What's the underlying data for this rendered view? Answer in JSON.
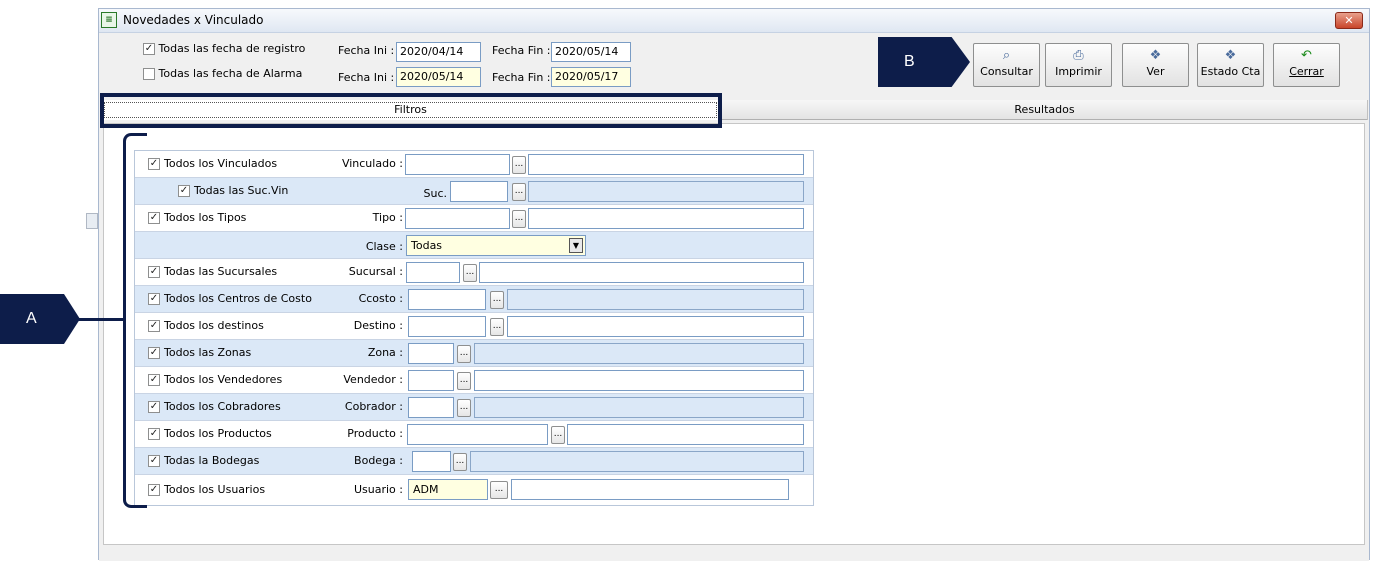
{
  "window": {
    "title": "Novedades x Vinculado",
    "close_label": "✕"
  },
  "date_options": [
    {
      "checked": true,
      "label": "Todas las fecha de registro",
      "ini_label": "Fecha Ini :",
      "ini_value": "2020/04/14",
      "fin_label": "Fecha Fin :",
      "fin_value": "2020/05/14",
      "highlight": false
    },
    {
      "checked": false,
      "label": "Todas las fecha de Alarma",
      "ini_label": "Fecha Ini :",
      "ini_value": "2020/05/14",
      "fin_label": "Fecha Fin :",
      "fin_value": "2020/05/17",
      "highlight": true
    }
  ],
  "toolbar": {
    "consultar": "Consultar",
    "imprimir": "Imprimir",
    "ver": "Ver",
    "estado_cta": "Estado Cta",
    "cerrar": "Cerrar"
  },
  "tabs": {
    "filtros": "Filtros",
    "resultados": "Resultados"
  },
  "filters": {
    "vinculados": {
      "check": "Todos los Vinculados",
      "label": "Vinculado :"
    },
    "suc_vin": {
      "check": "Todas las Suc.Vin",
      "label": "Suc."
    },
    "tipos": {
      "check": "Todos los Tipos",
      "label": "Tipo :"
    },
    "clase": {
      "label": "Clase :",
      "value": "Todas"
    },
    "sucursales": {
      "check": "Todas las Sucursales",
      "label": "Sucursal :"
    },
    "ccosto": {
      "check": "Todos los Centros de Costo",
      "label": "Ccosto :"
    },
    "destinos": {
      "check": "Todos los destinos",
      "label": "Destino :"
    },
    "zonas": {
      "check": "Todos las Zonas",
      "label": "Zona :"
    },
    "vendedores": {
      "check": "Todos los Vendedores",
      "label": "Vendedor :"
    },
    "cobradores": {
      "check": "Todos los Cobradores",
      "label": "Cobrador :"
    },
    "productos": {
      "check": "Todos los Productos",
      "label": "Producto :"
    },
    "bodegas": {
      "check": "Todas la Bodegas",
      "label": "Bodega :"
    },
    "usuarios": {
      "check": "Todos  los Usuarios",
      "label": "Usuario :",
      "value": "ADM"
    }
  },
  "annotations": {
    "a": "A",
    "b": "B"
  },
  "colors": {
    "annotation": "#0d1d4a",
    "alt_row": "#dbe8f7",
    "highlight_field": "#ffffe1"
  },
  "icons": {
    "check": "✓",
    "dots": "...",
    "dropdown": "▼"
  }
}
